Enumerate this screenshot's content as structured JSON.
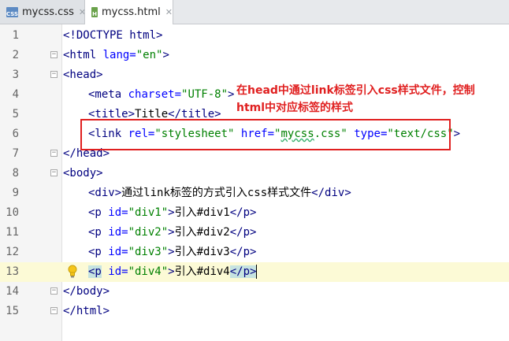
{
  "tabs": [
    {
      "label": "mycss.css",
      "icon": "css-file-icon",
      "active": false
    },
    {
      "label": "mycss.html",
      "icon": "html-file-icon",
      "active": true
    }
  ],
  "lines": [
    {
      "num": "1"
    },
    {
      "num": "2"
    },
    {
      "num": "3"
    },
    {
      "num": "4"
    },
    {
      "num": "5"
    },
    {
      "num": "6"
    },
    {
      "num": "7"
    },
    {
      "num": "8"
    },
    {
      "num": "9"
    },
    {
      "num": "10"
    },
    {
      "num": "11"
    },
    {
      "num": "12"
    },
    {
      "num": "13"
    },
    {
      "num": "14"
    },
    {
      "num": "15"
    }
  ],
  "code": {
    "l1": "<!DOCTYPE html>",
    "l2_tag": "<html",
    "l2_attr": " lang=",
    "l2_val": "\"en\"",
    "l2_end": ">",
    "l3": "<head>",
    "l4_tag": "<meta",
    "l4_attr": " charset=",
    "l4_val": "\"UTF-8\"",
    "l4_end": ">",
    "l5_open": "<title>",
    "l5_text": "Title",
    "l5_close": "</title>",
    "l6_tag": "<link",
    "l6_attr1": " rel=",
    "l6_val1": "\"stylesheet\"",
    "l6_attr2": " href=",
    "l6_val2a": "\"",
    "l6_val2b": "mycss",
    "l6_val2c": ".css\"",
    "l6_attr3": " type=",
    "l6_val3": "\"text/css\"",
    "l6_end": ">",
    "l7": "</head>",
    "l8": "<body>",
    "l9_open": "<div>",
    "l9_text": "通过link标签的方式引入css样式文件",
    "l9_close": "</div>",
    "l10_tag": "<p",
    "l10_attr": " id=",
    "l10_val": "\"div1\"",
    "l10_end": ">",
    "l10_text": "引入#div1",
    "l10_close": "</p>",
    "l11_tag": "<p",
    "l11_attr": " id=",
    "l11_val": "\"div2\"",
    "l11_end": ">",
    "l11_text": "引入#div2",
    "l11_close": "</p>",
    "l12_tag": "<p",
    "l12_attr": " id=",
    "l12_val": "\"div3\"",
    "l12_end": ">",
    "l12_text": "引入#div3",
    "l12_close": "</p>",
    "l13_tag": "<p",
    "l13_attr": " id=",
    "l13_val": "\"div4\"",
    "l13_end": ">",
    "l13_text": "引入#div4",
    "l13_close": "</p>",
    "l14": "</body>",
    "l15": "</html>"
  },
  "annotation": {
    "text": "在head中通过link标签引入css样式文件，控制html中对应标签的样式",
    "color": "#e02020"
  },
  "current_line": "13"
}
